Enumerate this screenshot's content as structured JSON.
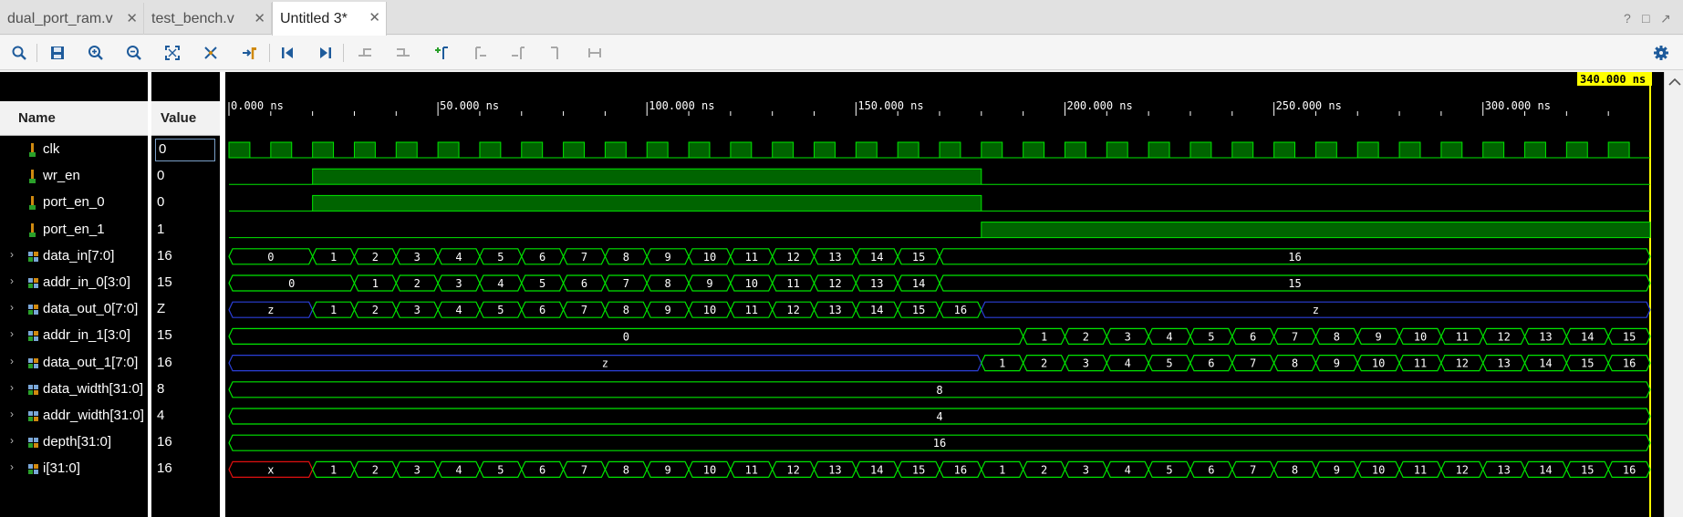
{
  "tabs": [
    {
      "label": "dual_port_ram.v"
    },
    {
      "label": "test_bench.v"
    },
    {
      "label": "Untitled 3*"
    }
  ],
  "window_controls": [
    "?",
    "□",
    "↗"
  ],
  "toolbar": {
    "items": [
      "search-icon",
      "save-icon",
      "zoom-in-icon",
      "zoom-out-icon",
      "zoom-fit-icon",
      "swap-cursor-icon",
      "go-to-cursor-icon",
      "go-to-start-icon",
      "go-to-end-icon",
      "previous-transition-icon",
      "next-transition-icon",
      "add-marker-icon",
      "previous-marker-icon",
      "next-marker-icon",
      "swap-markers-icon",
      "marker-range-icon"
    ],
    "settings_icon": "gear-icon"
  },
  "panels": {
    "name_header": "Name",
    "value_header": "Value"
  },
  "signals": [
    {
      "name": "clk",
      "value": "0",
      "type": "bit",
      "expandable": false,
      "selected": true
    },
    {
      "name": "wr_en",
      "value": "0",
      "type": "bit",
      "expandable": false
    },
    {
      "name": "port_en_0",
      "value": "0",
      "type": "bit",
      "expandable": false
    },
    {
      "name": "port_en_1",
      "value": "1",
      "type": "bit",
      "expandable": false
    },
    {
      "name": "data_in[7:0]",
      "value": "16",
      "type": "bus",
      "expandable": true
    },
    {
      "name": "addr_in_0[3:0]",
      "value": "15",
      "type": "bus",
      "expandable": true
    },
    {
      "name": "data_out_0[7:0]",
      "value": "Z",
      "type": "bus",
      "expandable": true
    },
    {
      "name": "addr_in_1[3:0]",
      "value": "15",
      "type": "bus",
      "expandable": true
    },
    {
      "name": "data_out_1[7:0]",
      "value": "16",
      "type": "bus",
      "expandable": true
    },
    {
      "name": "data_width[31:0]",
      "value": "8",
      "type": "param",
      "expandable": true
    },
    {
      "name": "addr_width[31:0]",
      "value": "4",
      "type": "param",
      "expandable": true
    },
    {
      "name": "depth[31:0]",
      "value": "16",
      "type": "param",
      "expandable": true
    },
    {
      "name": "i[31:0]",
      "value": "16",
      "type": "bus",
      "expandable": true
    }
  ],
  "waveform": {
    "cursor_label": "340.000 ns",
    "cursor_time_ns": 340,
    "view_start_ns": 0,
    "view_end_ns": 340,
    "time_ticks": [
      {
        "t": 0,
        "label": "0.000 ns"
      },
      {
        "t": 50,
        "label": "50.000 ns"
      },
      {
        "t": 100,
        "label": "100.000 ns"
      },
      {
        "t": 150,
        "label": "150.000 ns"
      },
      {
        "t": 200,
        "label": "200.000 ns"
      },
      {
        "t": 250,
        "label": "250.000 ns"
      },
      {
        "t": 300,
        "label": "300.000 ns"
      }
    ],
    "clock_period_ns": 10,
    "clock_edges": [
      0,
      10,
      20,
      30,
      40,
      50,
      60,
      70,
      80,
      90,
      100,
      110,
      120,
      130,
      140,
      150,
      160,
      170,
      180,
      190,
      200,
      210,
      220,
      230,
      240,
      250,
      260,
      270,
      280,
      290,
      300,
      310,
      320,
      330
    ],
    "bit_waves": {
      "wr_en": [
        [
          0,
          0
        ],
        [
          20,
          1
        ],
        [
          180,
          0
        ]
      ],
      "port_en_0": [
        [
          0,
          0
        ],
        [
          20,
          1
        ],
        [
          180,
          0
        ]
      ],
      "port_en_1": [
        [
          0,
          0
        ],
        [
          180,
          1
        ]
      ]
    },
    "bus_waves": {
      "data_in[7:0]": [
        [
          0,
          "0"
        ],
        [
          20,
          "1"
        ],
        [
          30,
          "2"
        ],
        [
          40,
          "3"
        ],
        [
          50,
          "4"
        ],
        [
          60,
          "5"
        ],
        [
          70,
          "6"
        ],
        [
          80,
          "7"
        ],
        [
          90,
          "8"
        ],
        [
          100,
          "9"
        ],
        [
          110,
          "10"
        ],
        [
          120,
          "11"
        ],
        [
          130,
          "12"
        ],
        [
          140,
          "13"
        ],
        [
          150,
          "14"
        ],
        [
          160,
          "15"
        ],
        [
          170,
          "16"
        ]
      ],
      "addr_in_0[3:0]": [
        [
          0,
          "0"
        ],
        [
          30,
          "1"
        ],
        [
          40,
          "2"
        ],
        [
          50,
          "3"
        ],
        [
          60,
          "4"
        ],
        [
          70,
          "5"
        ],
        [
          80,
          "6"
        ],
        [
          90,
          "7"
        ],
        [
          100,
          "8"
        ],
        [
          110,
          "9"
        ],
        [
          120,
          "10"
        ],
        [
          130,
          "11"
        ],
        [
          140,
          "12"
        ],
        [
          150,
          "13"
        ],
        [
          160,
          "14"
        ],
        [
          170,
          "15"
        ]
      ],
      "data_out_0[7:0]": [
        [
          0,
          "Z"
        ],
        [
          20,
          "1"
        ],
        [
          30,
          "2"
        ],
        [
          40,
          "3"
        ],
        [
          50,
          "4"
        ],
        [
          60,
          "5"
        ],
        [
          70,
          "6"
        ],
        [
          80,
          "7"
        ],
        [
          90,
          "8"
        ],
        [
          100,
          "9"
        ],
        [
          110,
          "10"
        ],
        [
          120,
          "11"
        ],
        [
          130,
          "12"
        ],
        [
          140,
          "13"
        ],
        [
          150,
          "14"
        ],
        [
          160,
          "15"
        ],
        [
          170,
          "16"
        ],
        [
          180,
          "Z"
        ]
      ],
      "addr_in_1[3:0]": [
        [
          0,
          "0"
        ],
        [
          190,
          "1"
        ],
        [
          200,
          "2"
        ],
        [
          210,
          "3"
        ],
        [
          220,
          "4"
        ],
        [
          230,
          "5"
        ],
        [
          240,
          "6"
        ],
        [
          250,
          "7"
        ],
        [
          260,
          "8"
        ],
        [
          270,
          "9"
        ],
        [
          280,
          "10"
        ],
        [
          290,
          "11"
        ],
        [
          300,
          "12"
        ],
        [
          310,
          "13"
        ],
        [
          320,
          "14"
        ],
        [
          330,
          "15"
        ]
      ],
      "data_out_1[7:0]": [
        [
          0,
          "Z"
        ],
        [
          180,
          "1"
        ],
        [
          190,
          "2"
        ],
        [
          200,
          "3"
        ],
        [
          210,
          "4"
        ],
        [
          220,
          "5"
        ],
        [
          230,
          "6"
        ],
        [
          240,
          "7"
        ],
        [
          250,
          "8"
        ],
        [
          260,
          "9"
        ],
        [
          270,
          "10"
        ],
        [
          280,
          "11"
        ],
        [
          290,
          "12"
        ],
        [
          300,
          "13"
        ],
        [
          310,
          "14"
        ],
        [
          320,
          "15"
        ],
        [
          330,
          "16"
        ]
      ],
      "data_width[31:0]": [
        [
          0,
          "8"
        ]
      ],
      "addr_width[31:0]": [
        [
          0,
          "4"
        ]
      ],
      "depth[31:0]": [
        [
          0,
          "16"
        ]
      ],
      "i[31:0]": [
        [
          0,
          "X"
        ],
        [
          20,
          "1"
        ],
        [
          30,
          "2"
        ],
        [
          40,
          "3"
        ],
        [
          50,
          "4"
        ],
        [
          60,
          "5"
        ],
        [
          70,
          "6"
        ],
        [
          80,
          "7"
        ],
        [
          90,
          "8"
        ],
        [
          100,
          "9"
        ],
        [
          110,
          "10"
        ],
        [
          120,
          "11"
        ],
        [
          130,
          "12"
        ],
        [
          140,
          "13"
        ],
        [
          150,
          "14"
        ],
        [
          160,
          "15"
        ],
        [
          170,
          "16"
        ],
        [
          180,
          "1"
        ],
        [
          190,
          "2"
        ],
        [
          200,
          "3"
        ],
        [
          210,
          "4"
        ],
        [
          220,
          "5"
        ],
        [
          230,
          "6"
        ],
        [
          240,
          "7"
        ],
        [
          250,
          "8"
        ],
        [
          260,
          "9"
        ],
        [
          270,
          "10"
        ],
        [
          280,
          "11"
        ],
        [
          290,
          "12"
        ],
        [
          300,
          "13"
        ],
        [
          310,
          "14"
        ],
        [
          320,
          "15"
        ],
        [
          330,
          "16"
        ]
      ]
    },
    "colors": {
      "wave": "#00e600",
      "fill": "#006400",
      "highz": "#2b3fd8",
      "unknown": "#e01010",
      "cursor": "#ffff00",
      "label": "#ffffff",
      "background": "#000000"
    }
  }
}
